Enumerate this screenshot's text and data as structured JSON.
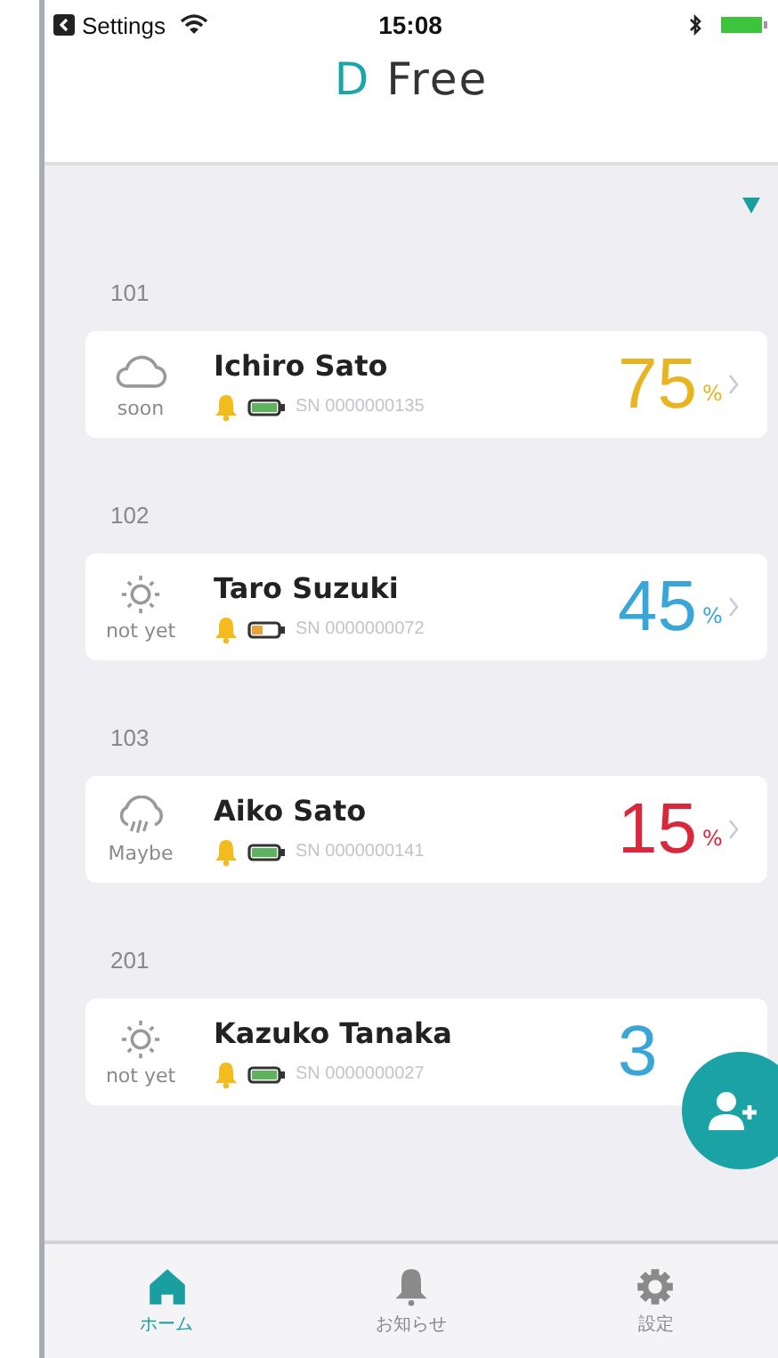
{
  "status_bar": {
    "back_label": "Settings",
    "time": "15:08"
  },
  "header": {
    "title_initial": "D",
    "title_rest": "Free"
  },
  "residents": [
    {
      "room": "101",
      "weather": {
        "kind": "cloud",
        "forecast": "soon"
      },
      "name": "Ichiro Sato",
      "battery_low": false,
      "serial": "SN 0000000135",
      "percent": "75",
      "unit": "%",
      "color": "#e8b422"
    },
    {
      "room": "102",
      "weather": {
        "kind": "sun",
        "forecast": "not yet"
      },
      "name": "Taro Suzuki",
      "battery_low": true,
      "serial": "SN 0000000072",
      "percent": "45",
      "unit": "%",
      "color": "#3aa6d8"
    },
    {
      "room": "103",
      "weather": {
        "kind": "rain",
        "forecast": "Maybe"
      },
      "name": "Aiko Sato",
      "battery_low": false,
      "serial": "SN 0000000141",
      "percent": "15",
      "unit": "%",
      "color": "#d8283c"
    },
    {
      "room": "201",
      "weather": {
        "kind": "sun",
        "forecast": "not yet"
      },
      "name": "Kazuko Tanaka",
      "battery_low": false,
      "serial": "SN 0000000027",
      "percent": "3",
      "color": "#3aa6d8"
    }
  ],
  "tabs": [
    {
      "label": "ホーム",
      "kind": "home",
      "selected": true
    },
    {
      "label": "お知らせ",
      "kind": "bell",
      "selected": false
    },
    {
      "label": "設定",
      "kind": "gear",
      "selected": false
    }
  ]
}
